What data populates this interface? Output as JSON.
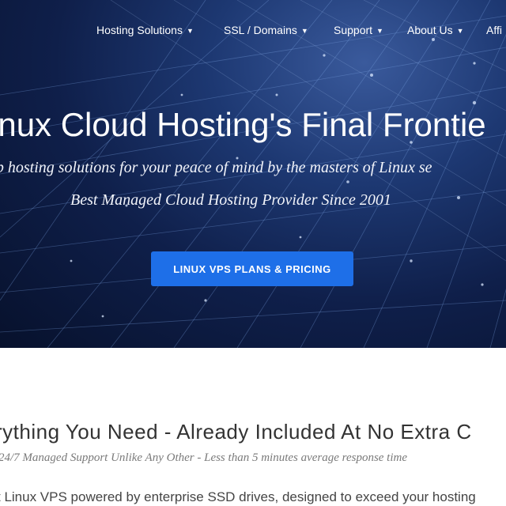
{
  "nav": {
    "items": [
      {
        "label": "Hosting Solutions"
      },
      {
        "label": "SSL / Domains"
      },
      {
        "label": "Support"
      },
      {
        "label": "About Us"
      },
      {
        "label": "Affi"
      }
    ]
  },
  "hero": {
    "title": "inux Cloud Hosting's Final Frontie",
    "subtitle": "eb hosting solutions for your peace of mind by the masters of Linux se",
    "subtitle2": "Best Managed Cloud Hosting Provider Since 2001",
    "cta_label": "LINUX VPS PLANS & PRICING",
    "cta_color": "#1e6fe8"
  },
  "section": {
    "title": "rything You Need - Already Included At No Extra C",
    "subtitle": "24/7 Managed Support Unlike Any Other - Less than 5 minutes average response time",
    "body": "t Linux VPS powered by enterprise SSD drives, designed to exceed your hosting"
  },
  "colors": {
    "hero_bg": "#0f1f4a",
    "accent": "#1e6fe8"
  }
}
